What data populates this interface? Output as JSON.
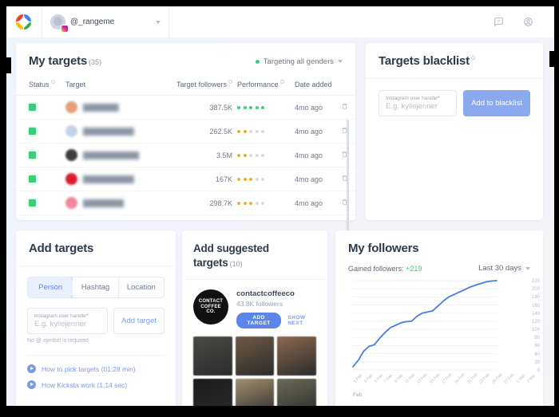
{
  "topnav": {
    "logo_icon": "kicksta-logo-icon",
    "account": {
      "handle": "@_rangeme",
      "chevron_icon": "chevron-down-icon",
      "ig_badge_icon": "instagram-badge-icon"
    },
    "icons": [
      {
        "name": "feedback-chat-icon",
        "glyph": "speech-bubble"
      },
      {
        "name": "account-circle-icon",
        "glyph": "user-circle"
      }
    ]
  },
  "targets": {
    "title": "My targets",
    "count": "(35)",
    "gender_filter": {
      "label": "Targeting all genders",
      "dot_color": "#3ec48a",
      "chevron_icon": "chevron-down-icon"
    },
    "columns": [
      {
        "label": "Status",
        "info": true
      },
      {
        "label": "Target",
        "info": false
      },
      {
        "label": "Target followers",
        "info": true
      },
      {
        "label": "Performance",
        "info": true
      },
      {
        "label": "Date added",
        "info": false
      }
    ],
    "rows": [
      {
        "status": "active",
        "name": "███████",
        "avatar_color": "#e8a07a",
        "followers": "387.5K",
        "perf_filled": 5,
        "perf_color": "green",
        "date": "4mo ago",
        "delete_icon": "trash-icon"
      },
      {
        "status": "active",
        "name": "██████████",
        "avatar_color": "#c3d4e8",
        "followers": "262.5K",
        "perf_filled": 2,
        "perf_color": "orange",
        "date": "4mo ago",
        "delete_icon": "trash-icon"
      },
      {
        "status": "active",
        "name": "███████████",
        "avatar_color": "#3e3e3e",
        "followers": "3.5M",
        "perf_filled": 2,
        "perf_color": "orange",
        "date": "4mo ago",
        "delete_icon": "trash-icon"
      },
      {
        "status": "active",
        "name": "██████████",
        "avatar_color": "#d81f31",
        "followers": "167K",
        "perf_filled": 3,
        "perf_color": "orange",
        "date": "4mo ago",
        "delete_icon": "trash-icon"
      },
      {
        "status": "active",
        "name": "████████",
        "avatar_color": "#ef8a9c",
        "followers": "298.7K",
        "perf_filled": 3,
        "perf_color": "orange",
        "date": "4mo ago",
        "delete_icon": "trash-icon"
      }
    ]
  },
  "blacklist": {
    "title": "Targets blacklist",
    "info_icon": "info-icon",
    "field_label": "Instagram user handle",
    "required_mark": "*",
    "placeholder": "E.g. kyliejenner",
    "button_label": "Add to blacklist",
    "button_color": "#8aa9ef"
  },
  "add_targets": {
    "title": "Add targets",
    "tabs": [
      {
        "label": "Person",
        "active": true
      },
      {
        "label": "Hashtag",
        "active": false
      },
      {
        "label": "Location",
        "active": false
      }
    ],
    "field_label": "Instagram user handle",
    "required_mark": "*",
    "placeholder": "E.g. kyliejenner",
    "button_label": "Add target",
    "hint": "No @ symbol is required",
    "videos": [
      {
        "label": "How to pick targets (01:28 min)",
        "icon": "play-icon"
      },
      {
        "label": "How Kicksta work (1:14 sec)",
        "icon": "play-icon"
      }
    ]
  },
  "suggested": {
    "title": "Add suggested targets",
    "count": "(10)",
    "profile": {
      "avatar_text": "CONTACT COFFEE CO.",
      "name": "contactcoffeeco",
      "followers": "43.8K followers",
      "add_label": "ADD TARGET",
      "next_label": "SHOW NEXT"
    },
    "thumbnails": [
      {
        "name": "post-thumbnail-1",
        "color": "#4a4a46"
      },
      {
        "name": "post-thumbnail-2",
        "color": "#6d5a44"
      },
      {
        "name": "post-thumbnail-3",
        "color": "#8a6a52"
      },
      {
        "name": "post-thumbnail-4",
        "color": "#1c1c1c"
      },
      {
        "name": "post-thumbnail-5",
        "color": "#a29070"
      },
      {
        "name": "post-thumbnail-6",
        "color": "#6a6a58"
      }
    ]
  },
  "followers": {
    "title": "My followers",
    "gained_label": "Gained followers:",
    "gained_value": "+219",
    "gained_color": "#3ecb7c",
    "range_label": "Last 30 days",
    "chevron_icon": "chevron-down-icon"
  },
  "chart_data": {
    "type": "line",
    "title": "My followers",
    "xlabel": "Feb",
    "ylabel": "",
    "ylim": [
      0,
      220
    ],
    "yticks": [
      220,
      200,
      180,
      160,
      140,
      120,
      100,
      80,
      60,
      40,
      20,
      0
    ],
    "grid": true,
    "legend": "none",
    "line_color": "#4a7ce8",
    "month_label": "Feb",
    "x": [
      "1 Feb",
      "3 Feb",
      "5 Feb",
      "7 Feb",
      "9 Feb",
      "11 Feb",
      "13 Feb",
      "15 Feb",
      "17 Feb",
      "19 Feb",
      "21 Feb",
      "23 Feb",
      "25 Feb",
      "27 Feb",
      "1 Mar",
      "3 Mar"
    ],
    "series": [
      {
        "name": "Gained followers",
        "values": [
          8,
          24,
          46,
          58,
          62,
          78,
          92,
          104,
          110,
          116,
          119,
          120,
          132,
          140,
          143,
          146,
          158,
          170,
          180,
          186,
          192,
          198,
          204,
          209,
          213,
          217,
          219,
          220
        ]
      }
    ]
  }
}
